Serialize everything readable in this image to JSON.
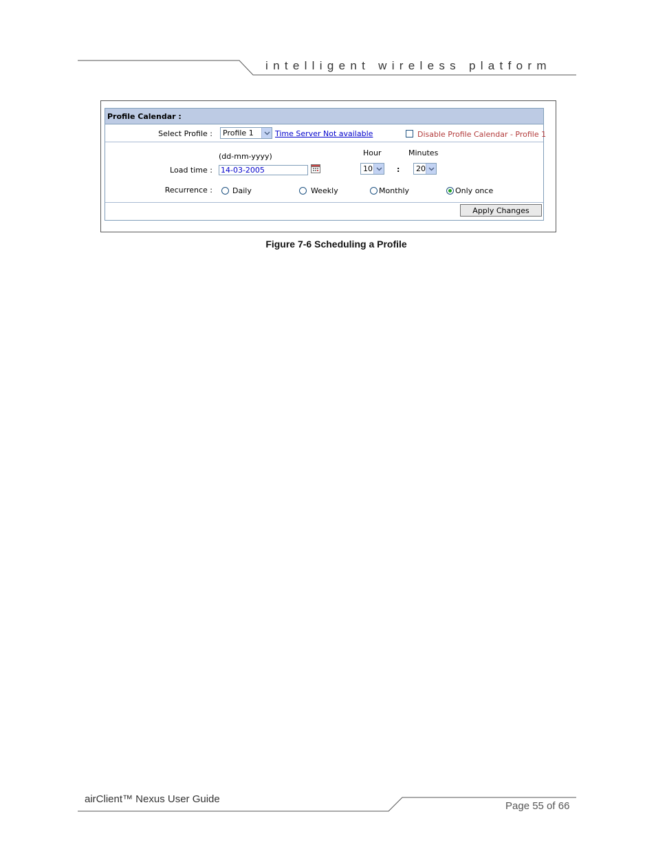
{
  "header": {
    "title": "intelligent wireless platform"
  },
  "figure": {
    "panel_title": "Profile Calendar :",
    "select_profile_label": "Select Profile :",
    "profile_value": "Profile 1",
    "time_server_link": "Time Server Not available",
    "disable_label": "Disable Profile Calendar - Profile 1",
    "disable_checked": false,
    "date_format": "(dd-mm-yyyy)",
    "hour_label": "Hour",
    "minutes_label": "Minutes",
    "load_time_label": "Load time :",
    "date_value": "14-03-2005",
    "hour_value": "10",
    "separator": ":",
    "minutes_value": "20",
    "recurrence_label": "Recurrence :",
    "recurrence_options": [
      "Daily",
      "Weekly",
      "Monthly",
      "Only once"
    ],
    "recurrence_selected": "Only once",
    "apply_button": "Apply Changes"
  },
  "caption": "Figure 7-6 Scheduling a Profile",
  "footer": {
    "left": "airClient™ Nexus User Guide",
    "right": "Page 55 of 66"
  },
  "colors": {
    "panel_header": "#bdcbe4",
    "link": "#0000cc",
    "checkbox_label": "#b23a3a",
    "radio_selected": "#21a121"
  }
}
